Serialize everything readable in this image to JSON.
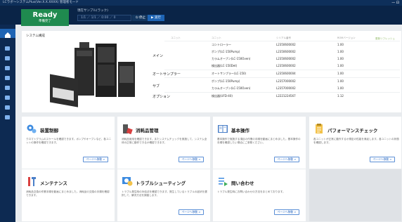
{
  "titlebar": {
    "text": "LCラボ〜システムPlus(Ver.X.X.XXXX) 管理者モード",
    "controls": "— ⊡"
  },
  "topbar": {
    "status_main": "Ready",
    "status_sub": "準備完了",
    "sample_title": "現在サンプル(ラック)",
    "sample_value": "1/1 ／ 1/1 ／ 0:00 ／ 0",
    "stop_label": "⏻ 停止",
    "run_label": "▶ 実行"
  },
  "sidebar": {
    "items": [
      "home-icon",
      "monitor-icon",
      "flask-icon",
      "clipboard-icon",
      "report-icon",
      "list-icon",
      "settings-icon",
      "user-icon",
      "export-icon"
    ]
  },
  "system": {
    "title": "システム構成",
    "update_label": "更新リフレッシュ",
    "headers": [
      "ユニット",
      "ユニット",
      "シリアル番号",
      "ROMバージョン"
    ],
    "groups": [
      {
        "name": "メイン",
        "rows": [
          {
            "unit": "コントローラー",
            "serial": "L2350600002",
            "version": "1.00"
          },
          {
            "unit": "ポンプ(LC-150Pump)",
            "serial": "L2350600002",
            "version": "1.00"
          },
          {
            "unit": "カラムオーブン(LC-150Oven)",
            "serial": "L2350600002",
            "version": "1.00"
          },
          {
            "unit": "検出器(LC-150Det)",
            "serial": "L2350600002",
            "version": "1.00"
          }
        ]
      },
      {
        "name": "オートサンプラー",
        "rows": [
          {
            "unit": "オートサンプラー(LC-150)",
            "serial": "L2350600004",
            "version": "1.00"
          }
        ]
      },
      {
        "name": "サブ",
        "rows": [
          {
            "unit": "ポンプ(LC-150Pump)",
            "serial": "L2357000002",
            "version": "1.00"
          },
          {
            "unit": "カラムオーブン(LC-150Oven)",
            "serial": "L2357000002",
            "version": "1.00"
          }
        ]
      },
      {
        "name": "オプション",
        "rows": [
          {
            "unit": "検出器(UFD-40)",
            "serial": "L2221224567",
            "version": "1.12"
          }
        ]
      }
    ]
  },
  "cards": [
    {
      "title": "装置制御",
      "desc": "クロマトグラムのスケールを確認できます。ポンプやオーブンなど、各ユニットの操作を確認できます。",
      "button": "ページへ移動 >"
    },
    {
      "title": "消耗品管理",
      "desc": "消耗品使用を確認できます。またシステムチェックを実施して、システム全体の正常に動作できるか確認できます。",
      "button": "ページへ移動 >"
    },
    {
      "title": "基本操作",
      "desc": "基本操作で実施する項目の作業の手順を動画にまとめました。基本操作の手順を確認したい場合にご参照ください。",
      "button": "ページへ移動 >"
    },
    {
      "title": "パフォーマンスチェック",
      "desc": "各ユニットが正常に動作するか規定の性能を満足します。各ユニットの状態を確認します。",
      "button": "ページへ移動 >"
    },
    {
      "title": "メンテナンス",
      "desc": "消耗品交換の作業手順を動画にまとめました。消耗品の交換の手順を確認できます。",
      "button": "ページへ移動 >"
    },
    {
      "title": "トラブルシューティング",
      "desc": "トラブル発生時の対処法を確認できます。発生しているトラブルの症状を選択して、解決方法を調査します。",
      "button": "ページへ移動 >"
    },
    {
      "title": "問い合わせ",
      "desc": "トラブル発生時にお問い合わせの方法をまとめております。",
      "button": "ページへ移動 >"
    }
  ]
}
